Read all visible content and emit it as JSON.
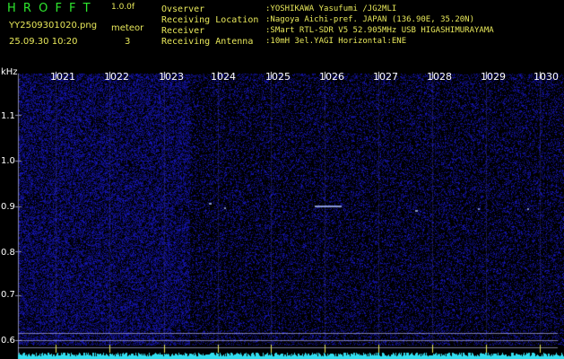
{
  "app": {
    "logo": "H R O F F T",
    "version": "1.0.0f"
  },
  "file": {
    "name": "YY2509301020.png",
    "datetime": "25.09.30 10:20"
  },
  "meteor": {
    "label": "meteor",
    "count": "3"
  },
  "info": [
    {
      "key": "Ovserver",
      "value": ":YOSHIKAWA Yasufumi /JG2MLI"
    },
    {
      "key": "Receiving Location",
      "value": ":Nagoya Aichi-pref. JAPAN (136.90E, 35.20N)"
    },
    {
      "key": "Receiver",
      "value": ":SMart RTL-SDR V5 52.905MHz USB HIGASHIMURAYAMA"
    },
    {
      "key": "Receiving Antenna",
      "value": ":10mH 3el.YAGI Horizontal:ENE"
    }
  ],
  "axis": {
    "unit": "kHz",
    "y_ticks": [
      "1.1",
      "1.0",
      "0.9",
      "0.8",
      "0.7",
      "0.6"
    ],
    "x_ticks": [
      "1021",
      "1022",
      "1023",
      "1024",
      "1025",
      "1026",
      "1027",
      "1028",
      "1029",
      "1030"
    ]
  },
  "colors": {
    "header_green": "#2ee72e",
    "version_yellow": "#e8e85a",
    "noise_blue": "#1a1aa0",
    "spectrum_cyan": "#33ddee"
  }
}
